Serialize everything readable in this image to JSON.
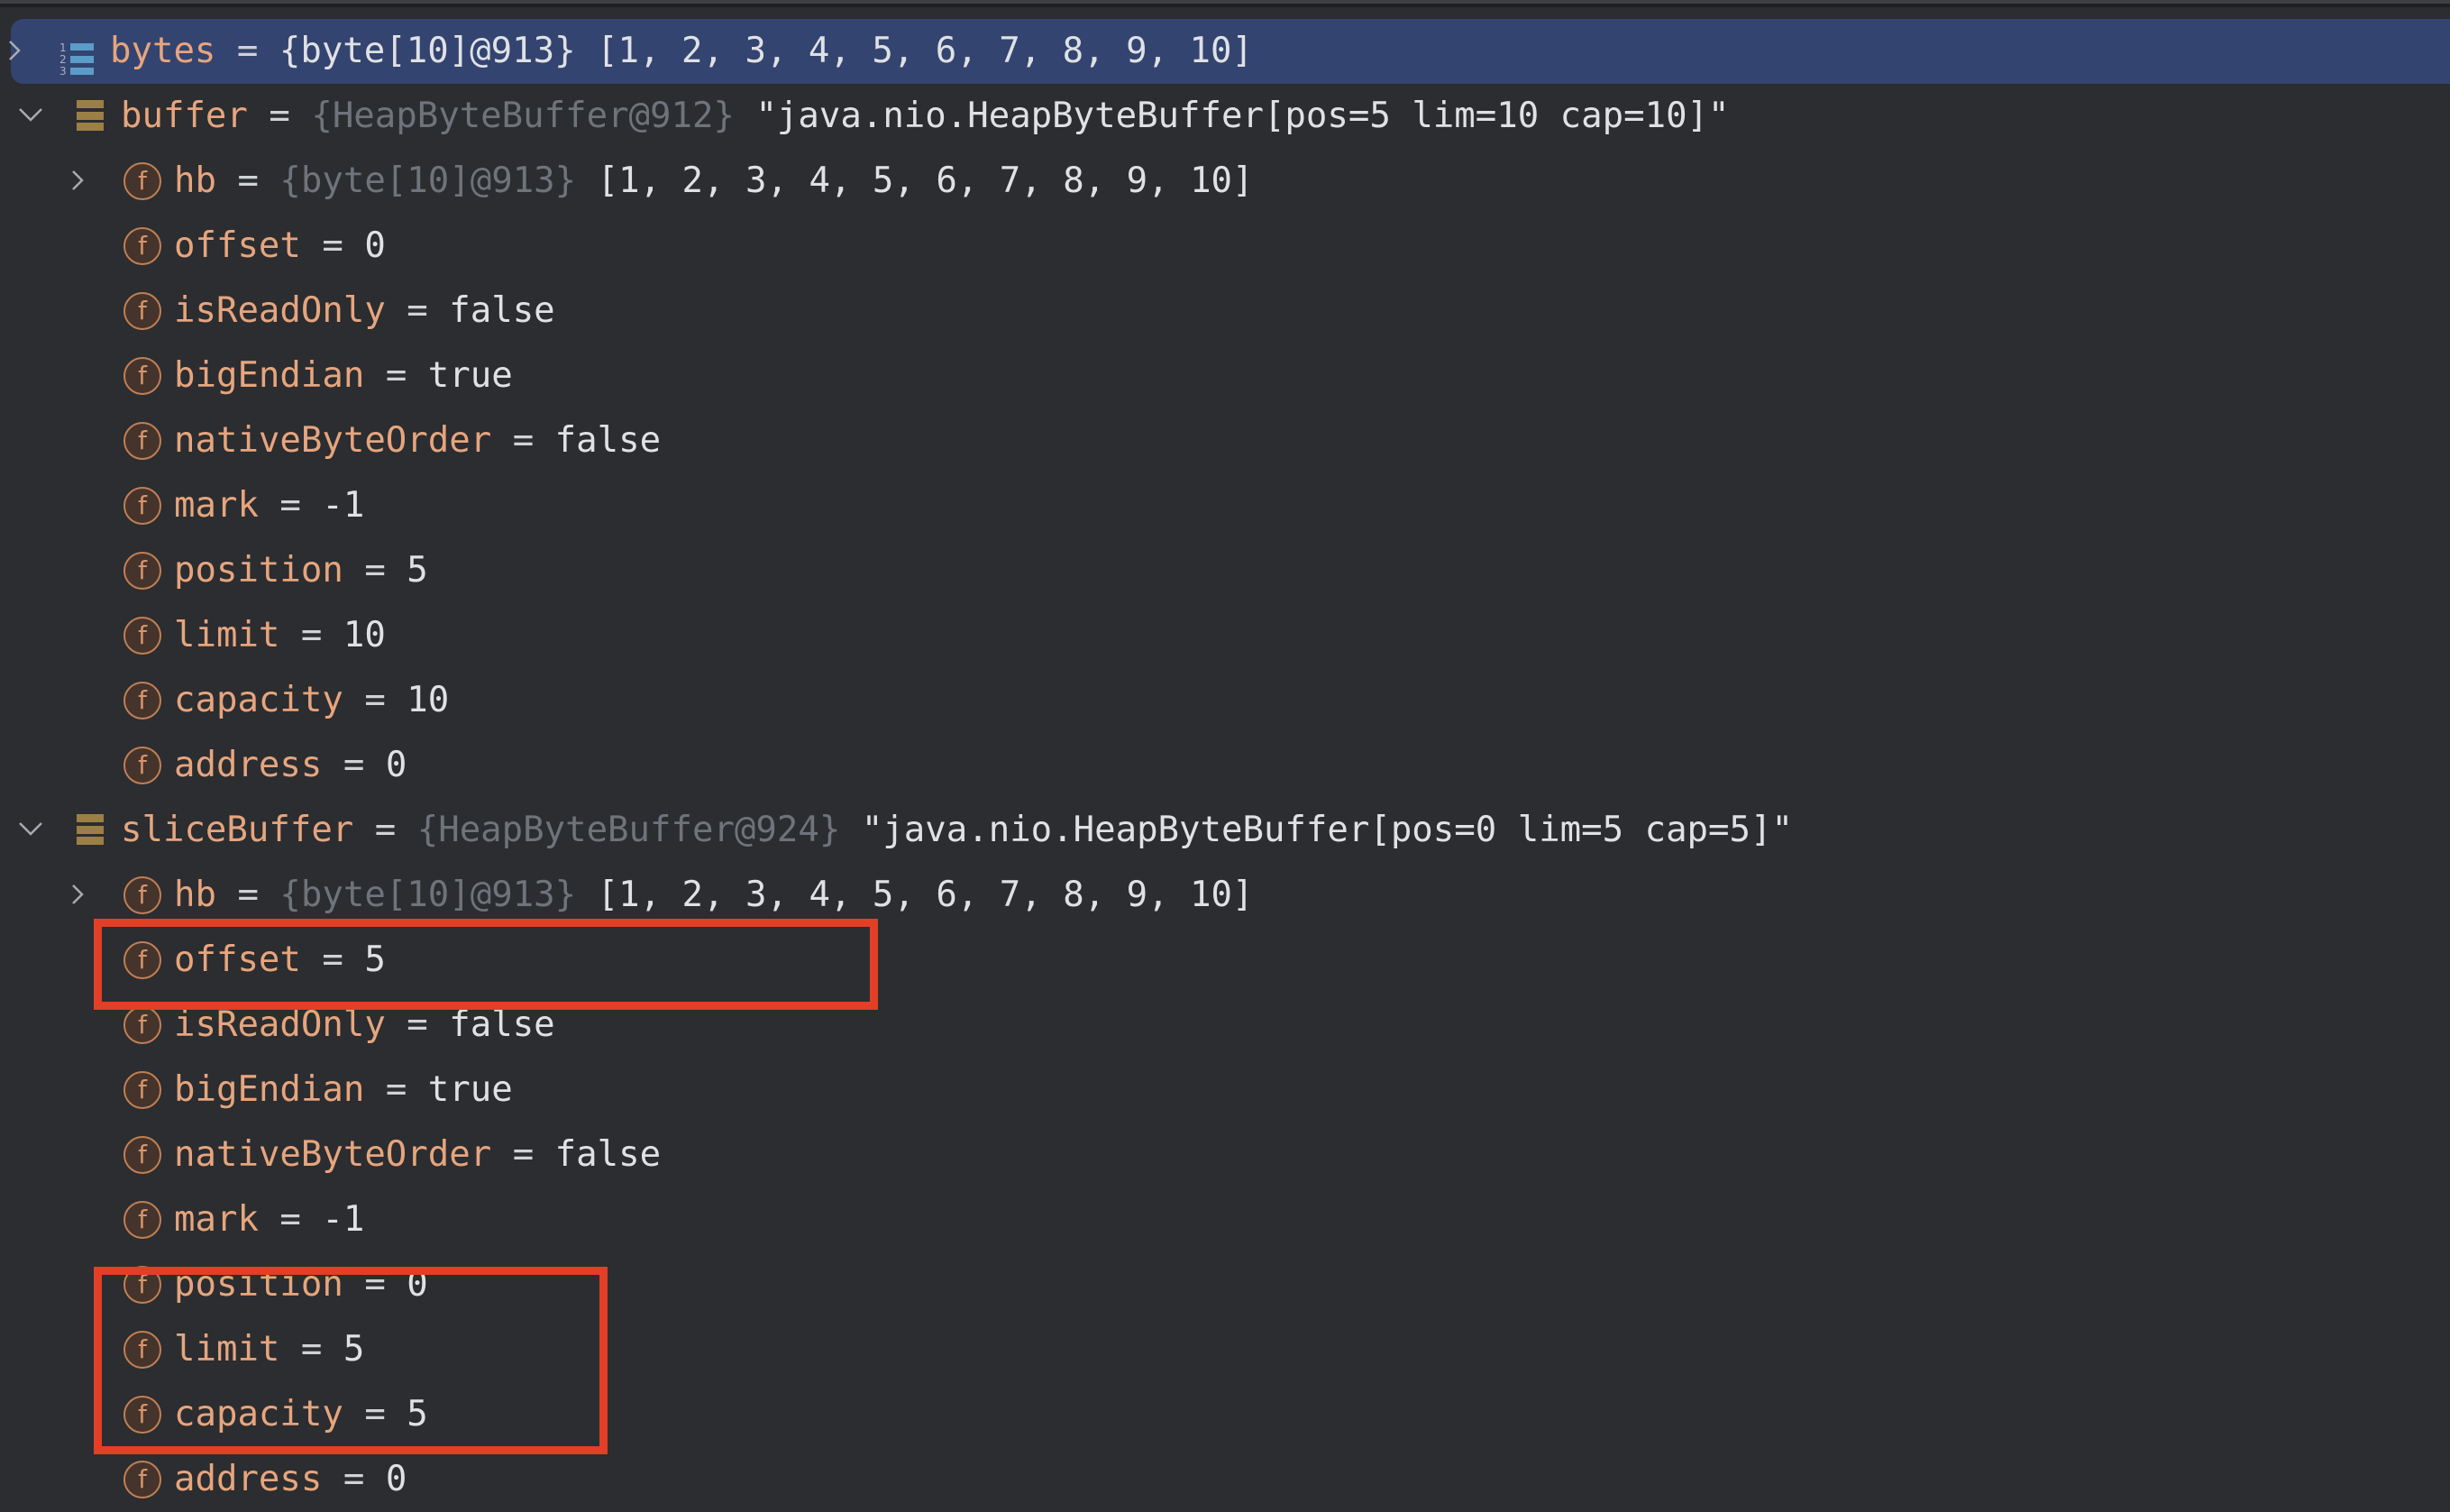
{
  "variables": [
    {
      "name": "bytes",
      "ref": "{byte[10]@913}",
      "value": "[1, 2, 3, 4, 5, 6, 7, 8, 9, 10]",
      "icon": "array-icon",
      "expanded": false,
      "selected": true
    },
    {
      "name": "buffer",
      "ref": "{HeapByteBuffer@912}",
      "value": "\"java.nio.HeapByteBuffer[pos=5 lim=10 cap=10]\"",
      "icon": "object-icon",
      "expanded": true,
      "fields": [
        {
          "name": "hb",
          "ref": "{byte[10]@913}",
          "value": "[1, 2, 3, 4, 5, 6, 7, 8, 9, 10]",
          "expandable": true
        },
        {
          "name": "offset",
          "value": "0"
        },
        {
          "name": "isReadOnly",
          "value": "false"
        },
        {
          "name": "bigEndian",
          "value": "true"
        },
        {
          "name": "nativeByteOrder",
          "value": "false"
        },
        {
          "name": "mark",
          "value": "-1"
        },
        {
          "name": "position",
          "value": "5"
        },
        {
          "name": "limit",
          "value": "10"
        },
        {
          "name": "capacity",
          "value": "10"
        },
        {
          "name": "address",
          "value": "0"
        }
      ]
    },
    {
      "name": "sliceBuffer",
      "ref": "{HeapByteBuffer@924}",
      "value": "\"java.nio.HeapByteBuffer[pos=0 lim=5 cap=5]\"",
      "icon": "object-icon",
      "expanded": true,
      "fields": [
        {
          "name": "hb",
          "ref": "{byte[10]@913}",
          "value": "[1, 2, 3, 4, 5, 6, 7, 8, 9, 10]",
          "expandable": true
        },
        {
          "name": "offset",
          "value": "5"
        },
        {
          "name": "isReadOnly",
          "value": "false"
        },
        {
          "name": "bigEndian",
          "value": "true"
        },
        {
          "name": "nativeByteOrder",
          "value": "false"
        },
        {
          "name": "mark",
          "value": "-1"
        },
        {
          "name": "position",
          "value": "0"
        },
        {
          "name": "limit",
          "value": "5"
        },
        {
          "name": "capacity",
          "value": "5"
        },
        {
          "name": "address",
          "value": "0"
        }
      ]
    }
  ],
  "equals_sign": "=",
  "field_icon_glyph": "f",
  "array_icon_digits": [
    "1",
    "2",
    "3"
  ],
  "annotations": [
    {
      "label": "highlight-offset",
      "covers": "sliceBuffer.offset"
    },
    {
      "label": "highlight-position-limit-capacity",
      "covers": "sliceBuffer.position, sliceBuffer.limit, sliceBuffer.capacity"
    }
  ],
  "colors": {
    "background": "#2b2d30",
    "selection": "#344470",
    "variable_name": "#e6a57e",
    "reference": "#6f737a",
    "value": "#dfe1e5",
    "object_icon": "#9c7f45",
    "array_icon": "#5b9cc9",
    "field_icon": "#c17f55",
    "annotation_box": "#e23f26"
  }
}
